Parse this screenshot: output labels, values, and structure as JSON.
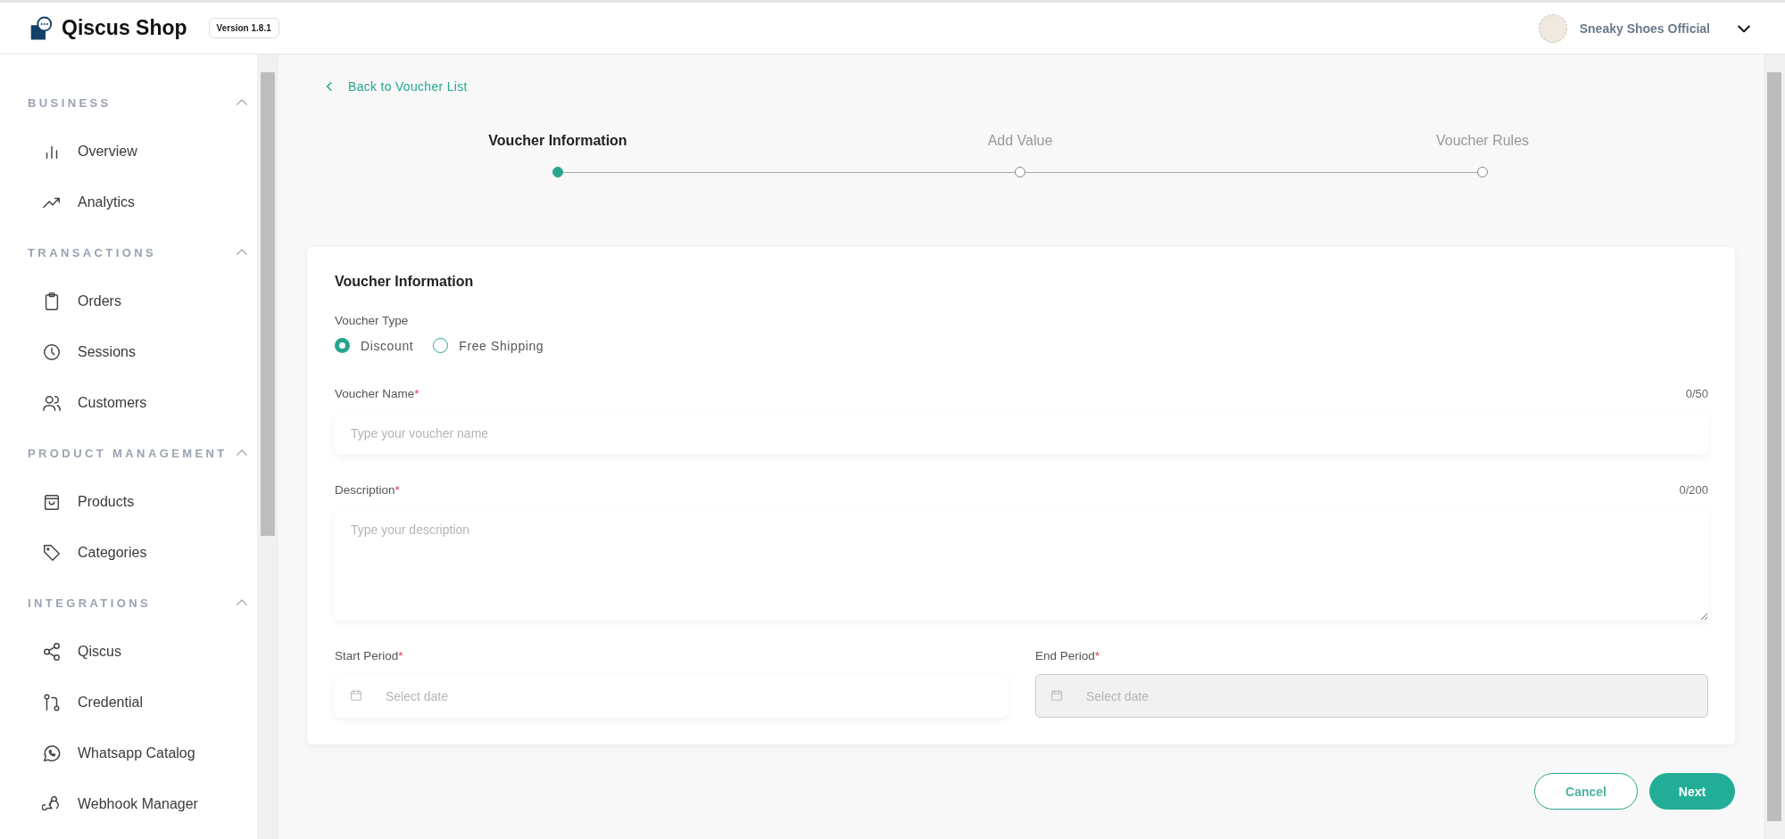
{
  "header": {
    "app_name": "Qiscus Shop",
    "version": "Version 1.8.1",
    "store_name": "Sneaky Shoes Official"
  },
  "sidebar": {
    "sections": [
      {
        "title": "BUSINESS",
        "expanded": true,
        "items": [
          "Overview",
          "Analytics"
        ]
      },
      {
        "title": "TRANSACTIONS",
        "expanded": true,
        "items": [
          "Orders",
          "Sessions",
          "Customers"
        ]
      },
      {
        "title": "PRODUCT MANAGEMENT",
        "expanded": true,
        "items": [
          "Products",
          "Categories"
        ]
      },
      {
        "title": "INTEGRATIONS",
        "expanded": true,
        "items": [
          "Qiscus",
          "Credential",
          "Whatsapp Catalog",
          "Webhook Manager"
        ]
      }
    ]
  },
  "back_link": "Back to Voucher List",
  "steps": [
    {
      "label": "Voucher Information",
      "selected": true
    },
    {
      "label": "Add Value",
      "selected": false
    },
    {
      "label": "Voucher Rules",
      "selected": false
    }
  ],
  "form": {
    "title": "Voucher Information",
    "voucher_type": {
      "label": "Voucher Type",
      "options": [
        {
          "label": "Discount",
          "selected": true
        },
        {
          "label": "Free Shipping",
          "selected": false
        }
      ]
    },
    "voucher_name": {
      "label": "Voucher Name",
      "required": "*",
      "counter": "0/50",
      "placeholder": "Type your voucher name"
    },
    "description": {
      "label": "Description",
      "required": "*",
      "counter": "0/200",
      "placeholder": "Type your description"
    },
    "periods": [
      {
        "label": "Start Period",
        "required": "*",
        "placeholder": "Select date",
        "disabled": false
      },
      {
        "label": "End Period",
        "required": "*",
        "placeholder": "Select date",
        "disabled": true
      }
    ]
  },
  "buttons": {
    "cancel": "Cancel",
    "next": "Next"
  }
}
